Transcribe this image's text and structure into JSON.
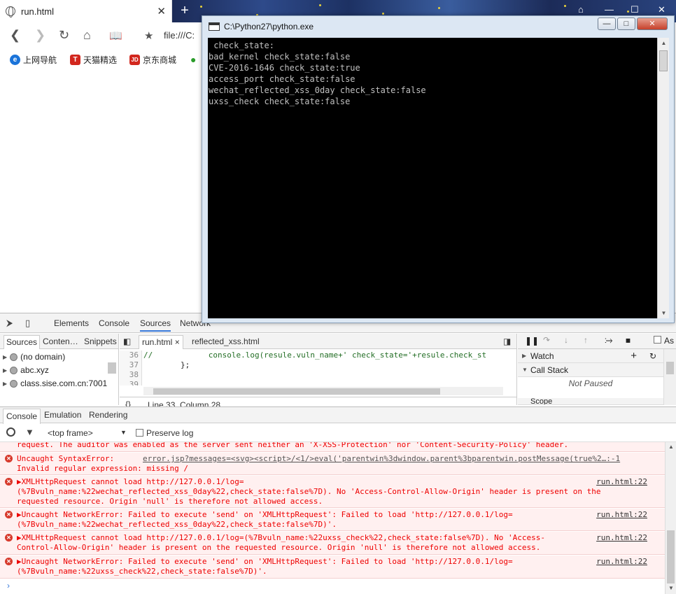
{
  "browser": {
    "tab_title": "run.html",
    "tab_close": "✕",
    "new_tab": "+",
    "url": "file:///C:",
    "window_controls": [
      "⌂",
      "—",
      "☐",
      "✕"
    ],
    "bookmarks": [
      {
        "icon_text": "e",
        "label": "上网导航",
        "color": "#1a73d9"
      },
      {
        "icon_text": "T",
        "label": "天猫精选",
        "color": "#d2271e"
      },
      {
        "icon_text": "JD",
        "label": "京东商城",
        "color": "#d2271e"
      }
    ]
  },
  "python_window": {
    "title": "C:\\Python27\\python.exe",
    "buttons": {
      "minimize": "—",
      "maximize": "□",
      "close": "✕"
    },
    "output_lines": [
      " check_state:",
      "bad_kernel check_state:false",
      "CVE-2016-1646 check_state:true",
      "access_port check_state:false",
      "wechat_reflected_xss_0day check_state:false",
      "uxss_check check_state:false"
    ]
  },
  "devtools": {
    "tabs": [
      "Elements",
      "Console",
      "Sources",
      "Network"
    ],
    "active_tab": "Sources",
    "navigator_tabs": [
      "Sources",
      "Conten…",
      "Snippets"
    ],
    "tree": [
      "(no domain)",
      "abc.xyz",
      "class.sise.com.cn:7001"
    ],
    "editor_tabs": [
      "run.html",
      "reflected_xss.html"
    ],
    "editor_tab_close": "×",
    "code_lines": [
      {
        "num": "36",
        "text": "//            console.log(resule.vuln_name+' check_state='+resule.check_st"
      },
      {
        "num": "37",
        "text": "        };"
      },
      {
        "num": "38",
        "text": ""
      },
      {
        "num": "39",
        "text": ""
      }
    ],
    "status": "Line 33, Column 28",
    "format_button": "{}",
    "watch": "Watch",
    "call_stack": "Call Stack",
    "not_paused": "Not Paused",
    "scope": "Scope",
    "async": "As",
    "drawer_tabs": [
      "Console",
      "Emulation",
      "Rendering"
    ],
    "frame": "<top frame>",
    "preserve_log": "Preserve log"
  },
  "console_messages": [
    {
      "lines": [
        "request. The auditor was enabled as the server sent neither an 'X-XSS-Protection' nor 'Content-Security-Policy' header."
      ],
      "icon": false,
      "source": ""
    },
    {
      "lines": [
        "Uncaught SyntaxError:",
        "Invalid regular expression: missing /"
      ],
      "icon": true,
      "source": "error.jsp?messages=<svg><script>/<1/>eval('parentwin%3dwindow.parent%3bparentwin.postMessage(true%2…:-1"
    },
    {
      "lines": [
        "▶XMLHttpRequest cannot load http://127.0.0.1/log=",
        "(%7Bvuln_name:%22wechat_reflected_xss_0day%22,check_state:false%7D). No 'Access-Control-Allow-Origin' header is present on the",
        "requested resource. Origin 'null' is therefore not allowed access."
      ],
      "icon": true,
      "source": "run.html:22"
    },
    {
      "lines": [
        "▶Uncaught NetworkError: Failed to execute 'send' on 'XMLHttpRequest': Failed to load 'http://127.0.0.1/log=",
        "(%7Bvuln_name:%22wechat_reflected_xss_0day%22,check_state:false%7D)'."
      ],
      "icon": true,
      "source": "run.html:22"
    },
    {
      "lines": [
        "▶XMLHttpRequest cannot load http://127.0.0.1/log=(%7Bvuln_name:%22uxss_check%22,check_state:false%7D). No 'Access-",
        "Control-Allow-Origin' header is present on the requested resource. Origin 'null' is therefore not allowed access."
      ],
      "icon": true,
      "source": "run.html:22"
    },
    {
      "lines": [
        "▶Uncaught NetworkError: Failed to execute 'send' on 'XMLHttpRequest': Failed to load 'http://127.0.0.1/log=",
        "(%7Bvuln_name:%22uxss_check%22,check_state:false%7D)'."
      ],
      "icon": true,
      "source": "run.html:22"
    }
  ],
  "console_prompt": "›"
}
